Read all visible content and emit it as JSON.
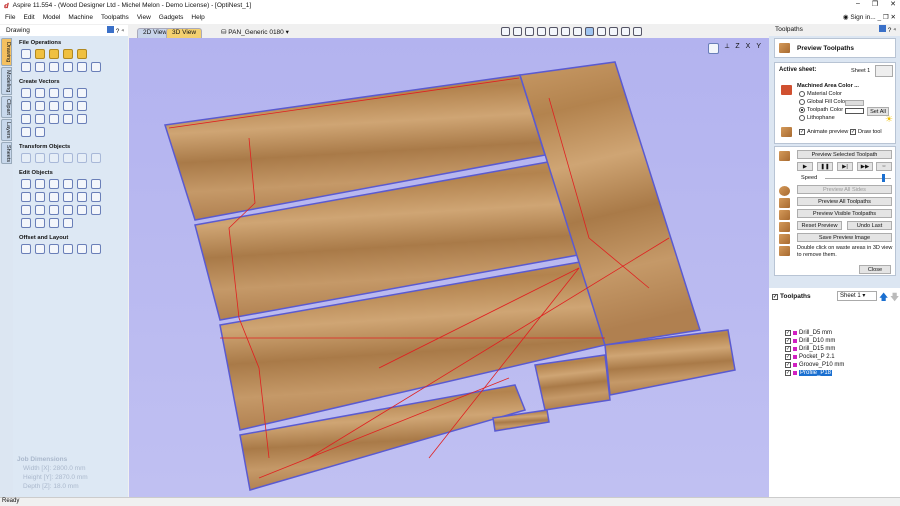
{
  "window": {
    "title": "Aspire 11.554 - (Wood Designer Ltd - Michel Melon - Demo License) - [OptiNest_1]",
    "controls": [
      "–",
      "❐",
      "✕"
    ],
    "sign_in": "Sign in..."
  },
  "menu": [
    "File",
    "Edit",
    "Model",
    "Machine",
    "Toolpaths",
    "View",
    "Gadgets",
    "Help"
  ],
  "left_panel": {
    "title": "Drawing",
    "controls": "? ⁴",
    "tabs": [
      "Drawing",
      "Modeling",
      "Clipart",
      "Layers",
      "Sheets"
    ],
    "sections": [
      {
        "label": "File Operations",
        "rows": [
          5,
          6
        ]
      },
      {
        "label": "Create Vectors",
        "rows": [
          5,
          5,
          5,
          2
        ]
      },
      {
        "label": "Transform Objects",
        "rows": [
          6
        ]
      },
      {
        "label": "Edit Objects",
        "rows": [
          6,
          6,
          6,
          4
        ]
      },
      {
        "label": "Offset and Layout",
        "rows": [
          6
        ]
      }
    ],
    "job_dimensions": {
      "title": "Job Dimensions",
      "width": "Width  [X]: 2800.0 mm",
      "height": "Height [Y]: 2870.0 mm",
      "depth": "Depth  [Z]: 18.0 mm"
    }
  },
  "view": {
    "tabs": [
      "2D View",
      "3D View"
    ],
    "active_tab": "3D View",
    "machine": "PAN_Generic 0180 ▾",
    "axis_labels": [
      "Z",
      "X",
      "Y"
    ],
    "background_color": "#b3b3ef"
  },
  "right_panel": {
    "title": "Toolpaths",
    "controls": "? ⁴",
    "preview_title": "Preview Toolpaths",
    "active_sheet_label": "Active sheet:",
    "active_sheet_value": "Sheet 1",
    "machined_area_title": "Machined Area Color ...",
    "color_options": [
      {
        "label": "Material Color",
        "selected": false
      },
      {
        "label": "Global Fill Color",
        "selected": false
      },
      {
        "label": "Toolpath Color",
        "selected": true
      },
      {
        "label": "Lithophane",
        "selected": false
      }
    ],
    "set_all": "Set All",
    "animate_preview": "Animate preview",
    "draw_tool": "Draw tool",
    "preview_selected": "Preview Selected Toolpath",
    "speed_label": "Speed",
    "speed_value": 0.9,
    "preview_all_sides": "Preview All Sides",
    "preview_all": "Preview All Toolpaths",
    "preview_visible": "Preview Visible Toolpaths",
    "reset_preview": "Reset Preview",
    "undo_last": "Undo Last",
    "save_preview": "Save Preview Image",
    "hint": "Double click on waste areas in 3D view to remove them.",
    "close": "Close",
    "toolpaths_label": "Toolpaths",
    "sheet_select": "Sheet 1",
    "toolpaths": [
      {
        "name": "Drill_D5 mm",
        "checked": true,
        "selected": false
      },
      {
        "name": "Drill_D10 mm",
        "checked": true,
        "selected": false
      },
      {
        "name": "Drill_D15 mm",
        "checked": true,
        "selected": false
      },
      {
        "name": "Pocket_P 2.1",
        "checked": true,
        "selected": false
      },
      {
        "name": "Groove_P10 mm",
        "checked": true,
        "selected": false
      },
      {
        "name": "Profile_P18",
        "checked": true,
        "selected": true
      }
    ]
  },
  "status": "Ready"
}
